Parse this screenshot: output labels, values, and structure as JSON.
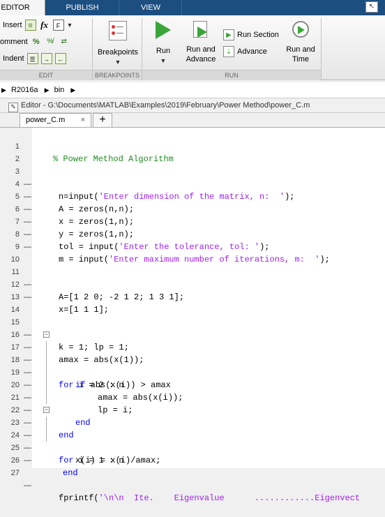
{
  "tabs": [
    "EDITOR",
    "PUBLISH",
    "VIEW"
  ],
  "ribbon": {
    "edit": {
      "insert": "Insert",
      "comment": "omment",
      "indent": "Indent",
      "fx": "fx",
      "label": "EDIT"
    },
    "breakpoints": {
      "button": "Breakpoints",
      "label": "BREAKPOINTS"
    },
    "run": {
      "run": "Run",
      "run_advance_1": "Run and",
      "run_advance_2": "Advance",
      "run_section": "Run Section",
      "advance": "Advance",
      "run_time_1": "Run and",
      "run_time_2": "Time",
      "label": "RUN"
    }
  },
  "path": [
    "R2016a",
    "bin"
  ],
  "editor_title": "Editor - G:\\Documents\\MATLAB\\Examples\\2019\\February\\Power Method\\power_C.m",
  "file_tab": {
    "name": "power_C.m",
    "close": "×",
    "new": "+"
  },
  "code": {
    "l1": "% Power Method Algorithm",
    "l3a": "n=input(",
    "l3s": "'Enter dimension of the matrix, n:  '",
    "l3b": ");",
    "l4": "A = zeros(n,n);",
    "l5": "x = zeros(1,n);",
    "l6": "y = zeros(1,n);",
    "l7a": "tol = input(",
    "l7s": "'Enter the tolerance, tol: '",
    "l7b": ");",
    "l8a": "m = input(",
    "l8s": "'Enter maximum number of iterations, m:  '",
    "l8b": ");",
    "l11": "A=[1 2 0; -2 1 2; 1 3 1];",
    "l12": "x=[1 1 1];",
    "l15": "k = 1; lp = 1;",
    "l16": "amax = abs(x(1));",
    "l17k": "for",
    "l17b": " i = 2 : n",
    "l18k": "if",
    "l18b": " abs(x(i)) > amax",
    "l19": "amax = abs(x(i));",
    "l20": "lp = i;",
    "l21": "end",
    "l22": "end",
    "l23k": "for",
    "l23b": " i = 1 : n",
    "l24": "x(i) = x(i)/amax;",
    "l25": "end",
    "l27a": "fprintf(",
    "l27s": "'\\n\\n  Ite.    Eigenvalue      ............Eigenvect"
  },
  "line_numbers": [
    "1",
    "2",
    "3",
    "4",
    "5",
    "6",
    "7",
    "8",
    "9",
    "10",
    "11",
    "12",
    "13",
    "14",
    "15",
    "16",
    "17",
    "18",
    "19",
    "20",
    "21",
    "22",
    "23",
    "24",
    "25",
    "26",
    "27"
  ],
  "dash": "—"
}
